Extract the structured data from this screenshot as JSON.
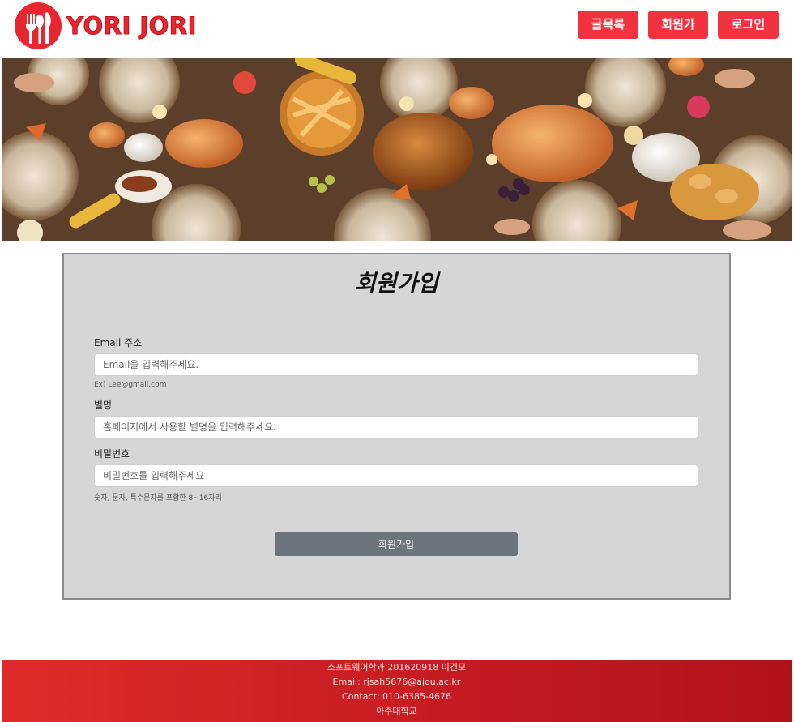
{
  "header": {
    "logo_text": "YORI JORI",
    "nav": [
      {
        "label": "글목록"
      },
      {
        "label": "회원가입"
      },
      {
        "label": "로그인"
      }
    ]
  },
  "banner": {
    "alt": "Thanksgiving feast table"
  },
  "form": {
    "title": "회원가입",
    "email": {
      "label": "Email 주소",
      "placeholder": "Email을 입력해주세요.",
      "hint": "Ex) Lee@gmail.com"
    },
    "nickname": {
      "label": "별명",
      "placeholder": "홈페이지에서 사용할 별명을 입력해주세요."
    },
    "password": {
      "label": "비밀번호",
      "placeholder": "비밀번호를 입력해주세요",
      "hint": "숫자, 문자, 특수문자를 포함한 8~16자리"
    },
    "submit_label": "회원가입"
  },
  "footer": {
    "line1": "소프트웨어학과 201620918 이건모",
    "line2": "Email: rjsah5676@ajou.ac.kr",
    "line3": "Contact: 010-6385-4676",
    "line4": "아주대학교"
  },
  "colors": {
    "brand_red": "#e8262f",
    "nav_button": "#f2323f",
    "panel_bg": "#d6d6d6",
    "submit_button": "#6c757d",
    "footer_red": "#c81d22"
  },
  "icons": [
    "utensils-logo-icon"
  ]
}
